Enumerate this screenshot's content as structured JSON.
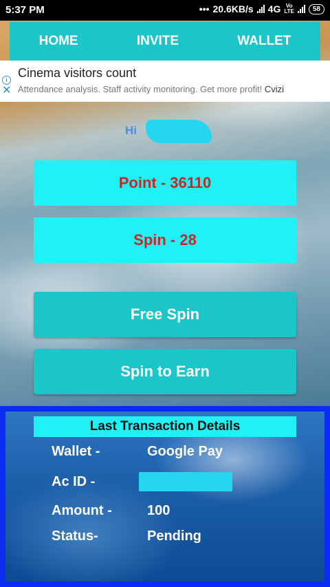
{
  "status_bar": {
    "time": "5:37 PM",
    "network_speed": "20.6KB/s",
    "network_type": "4G",
    "volte": "Vo",
    "lte": "LTE",
    "battery": "58"
  },
  "nav": {
    "tabs": [
      "HOME",
      "INVITE",
      "WALLET"
    ]
  },
  "ad": {
    "title": "Cinema visitors count",
    "text": "Attendance analysis. Staff activity monitoring. Get more profit!",
    "brand": "Cvizi"
  },
  "greeting": "Hi",
  "stats": {
    "points": "Point - 36110",
    "spins": "Spin - 28"
  },
  "actions": {
    "free_spin": "Free Spin",
    "spin_to_earn": "Spin to Earn"
  },
  "last_transaction": {
    "title": "Last Transaction Details",
    "wallet_label": "Wallet -",
    "wallet_value": "Google Pay",
    "acid_label": "Ac ID -",
    "amount_label": "Amount -",
    "amount_value": "100",
    "status_label": "Status-",
    "status_value": "Pending"
  },
  "colors": {
    "accent": "#1cc5c8",
    "highlight": "#1ef2f7",
    "point_text": "#c62828",
    "panel_border": "#0b2cf2"
  }
}
